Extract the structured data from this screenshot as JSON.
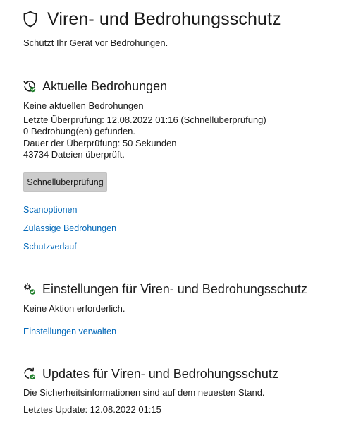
{
  "header": {
    "title": "Viren- und Bedrohungsschutz",
    "subtitle": "Schützt Ihr Gerät vor Bedrohungen.",
    "icon": "shield-icon"
  },
  "current_threats": {
    "icon": "scan-clock-icon",
    "title": "Aktuelle Bedrohungen",
    "status": "Keine aktuellen Bedrohungen",
    "last_scan": "Letzte Überprüfung: 12.08.2022 01:16 (Schnellüberprüfung)",
    "threats_found": "0 Bedrohung(en) gefunden.",
    "duration": "Dauer der Überprüfung: 50 Sekunden",
    "files_checked": "43734 Dateien überprüft.",
    "quick_scan_button": "Schnellüberprüfung",
    "links": {
      "scan_options": "Scanoptionen",
      "allowed_threats": "Zulässige Bedrohungen",
      "protection_history": "Schutzverlauf"
    }
  },
  "settings": {
    "icon": "settings-gears-icon",
    "title": "Einstellungen für Viren- und Bedrohungsschutz",
    "status": "Keine Aktion erforderlich.",
    "manage_link": "Einstellungen verwalten"
  },
  "updates": {
    "icon": "update-refresh-icon",
    "title": "Updates für Viren- und Bedrohungsschutz",
    "status": "Die Sicherheitsinformationen sind auf dem neuesten Stand.",
    "last_update": "Letztes Update: 12.08.2022 01:15"
  },
  "colors": {
    "link": "#0067b8",
    "ok_badge": "#1e7f2a",
    "button_bg": "#cccccc"
  }
}
